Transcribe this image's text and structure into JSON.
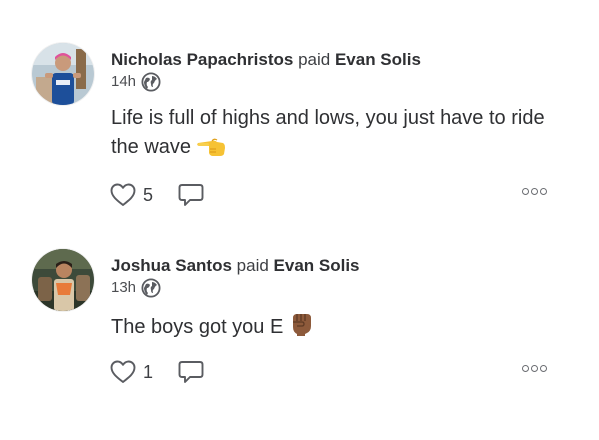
{
  "feed": {
    "stories": [
      {
        "actor": "Nicholas Papachristos",
        "verb": "paid",
        "target": "Evan Solis",
        "time": "14h",
        "message": "Life is full of highs and lows, you just have to ride the wave",
        "emoji": "point-left-emoji",
        "like_count": "5",
        "icons": {
          "like": "heart-icon",
          "comment": "comment-icon",
          "more": "more-icon",
          "privacy": "globe-icon"
        }
      },
      {
        "actor": "Joshua Santos",
        "verb": "paid",
        "target": "Evan Solis",
        "time": "13h",
        "message": "The boys got you E",
        "emoji": "raised-fist-emoji",
        "like_count": "1",
        "icons": {
          "like": "heart-icon",
          "comment": "comment-icon",
          "more": "more-icon",
          "privacy": "globe-icon"
        }
      }
    ]
  },
  "colors": {
    "text": "#2f3033",
    "icon": "#5a5c61",
    "background": "#ffffff"
  }
}
